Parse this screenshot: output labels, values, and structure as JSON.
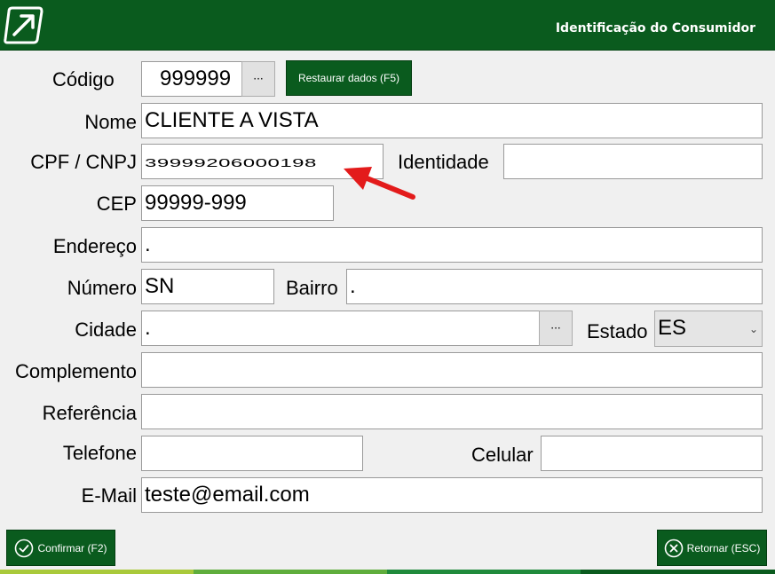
{
  "header": {
    "title": "Identificação do Consumidor"
  },
  "form": {
    "codigo": {
      "label": "Código",
      "value": "999999",
      "lookup": "···"
    },
    "restore_label": "Restaurar dados (F5)",
    "nome": {
      "label": "Nome",
      "value": "CLIENTE A VISTA"
    },
    "cpf": {
      "label": "CPF / CNPJ",
      "value": "39999206000198"
    },
    "identidade": {
      "label": "Identidade",
      "value": ""
    },
    "cep": {
      "label": "CEP",
      "value": "99999-999"
    },
    "endereco": {
      "label": "Endereço",
      "value": "."
    },
    "numero": {
      "label": "Número",
      "value": "SN"
    },
    "bairro": {
      "label": "Bairro",
      "value": "."
    },
    "cidade": {
      "label": "Cidade",
      "value": ".",
      "lookup": "···"
    },
    "estado": {
      "label": "Estado",
      "value": "ES"
    },
    "complemento": {
      "label": "Complemento",
      "value": ""
    },
    "referencia": {
      "label": "Referência",
      "value": ""
    },
    "telefone": {
      "label": "Telefone",
      "value": ""
    },
    "celular": {
      "label": "Celular",
      "value": ""
    },
    "email": {
      "label": "E-Mail",
      "value": "teste@email.com"
    }
  },
  "footer": {
    "confirm_label": "Confirmar (F2)",
    "back_label": "Retornar (ESC)"
  },
  "colors": {
    "brand": "#0a5b1e",
    "annotation": "#e31b1b"
  },
  "icons": [
    "logo-arrow-icon",
    "check-circle-icon",
    "close-circle-icon",
    "chevron-down-icon",
    "red-arrow-annotation"
  ]
}
